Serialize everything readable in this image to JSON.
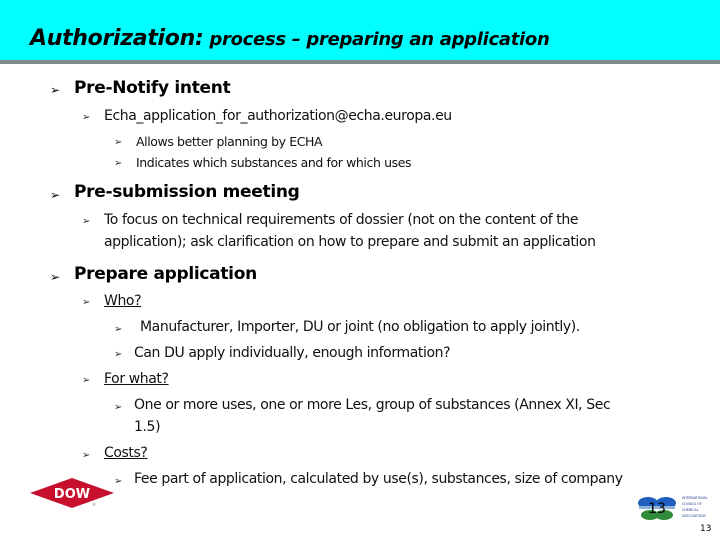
{
  "slide": {
    "title_main": "Authorization:",
    "title_sub": " process – preparing an application",
    "page_number": "13",
    "colors": {
      "title_band": "#00ffff",
      "title_rule": "#7f8c8c",
      "dow_red": "#c8102e"
    }
  },
  "content": {
    "pre_notify": {
      "label": "Pre-Notify intent",
      "email": "Echa_application_for_authorization@echa.europa.eu",
      "items": [
        "Allows better planning by ECHA",
        "Indicates which substances and for which uses"
      ]
    },
    "pre_submission": {
      "label": "Pre-submission meeting",
      "text_line1": "To focus on technical requirements of dossier (not on the content of the",
      "text_line2": "application); ask clarification on how to prepare and submit an application"
    },
    "prepare": {
      "label": "Prepare application",
      "who": {
        "label": "Who?",
        "items": [
          "Manufacturer, Importer, DU or joint (no obligation to apply jointly).",
          "Can DU apply individually, enough information?"
        ]
      },
      "for_what": {
        "label": "For what?",
        "item_line1": "One or more uses, one or more Les, group of substances (Annex XI, Sec",
        "item_line2": "1.5)"
      },
      "costs": {
        "label": "Costs?",
        "item": "Fee part of application, calculated by use(s), substances, size of company"
      }
    }
  },
  "bullet_glyph": "➢",
  "logos": {
    "dow": "DOW",
    "icca_number": "13",
    "icca_lines": [
      "INTERNATIONAL",
      "COUNCIL OF",
      "CHEMICAL",
      "ASSOCIATIONS"
    ]
  }
}
